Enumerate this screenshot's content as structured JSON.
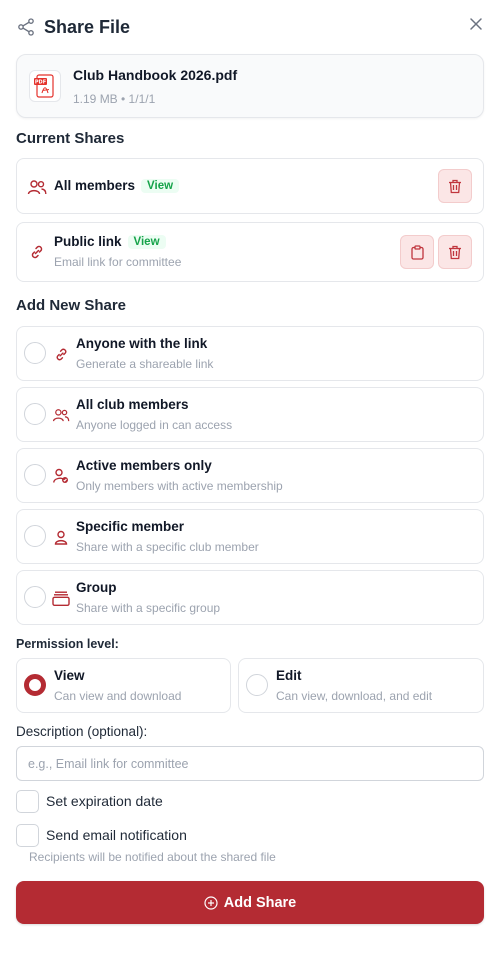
{
  "dialog": {
    "title": "Share File",
    "share_icon": "share-icon",
    "close_icon": "close-icon"
  },
  "file": {
    "name": "Club Handbook 2026.pdf",
    "meta": "1.19 MB • 1/1/1",
    "icon": "pdf-file-icon"
  },
  "current_shares": {
    "title": "Current Shares",
    "items": [
      {
        "label": "All members",
        "badge": "View",
        "icon": "users-icon"
      },
      {
        "label": "Public link",
        "badge": "View",
        "subtitle": "Email link for committee",
        "icon": "link-icon"
      }
    ]
  },
  "add_share": {
    "title": "Add New Share",
    "options": [
      {
        "label": "Anyone with the link",
        "subtitle": "Generate a shareable link",
        "icon": "link-icon"
      },
      {
        "label": "All club members",
        "subtitle": "Anyone logged in can access",
        "icon": "users-icon"
      },
      {
        "label": "Active members only",
        "subtitle": "Only members with active membership",
        "icon": "user-check-icon"
      },
      {
        "label": "Specific member",
        "subtitle": "Share with a specific club member",
        "icon": "user-icon"
      },
      {
        "label": "Group",
        "subtitle": "Share with a specific group",
        "icon": "group-icon"
      }
    ]
  },
  "permission": {
    "label": "Permission level:",
    "options": [
      {
        "label": "View",
        "subtitle": "Can view and download",
        "selected": true
      },
      {
        "label": "Edit",
        "subtitle": "Can view, download, and edit",
        "selected": false
      }
    ]
  },
  "description": {
    "label": "Description (optional):",
    "placeholder": "e.g., Email link for committee",
    "value": ""
  },
  "expiration": {
    "label": "Set expiration date",
    "checked": false
  },
  "notification": {
    "label": "Send email notification",
    "checked": false,
    "hint": "Recipients will be notified about the shared file"
  },
  "submit": {
    "label": "Add Share",
    "icon": "plus-circle-icon"
  },
  "colors": {
    "primary": "#b42b33",
    "badge_text": "#16a34a",
    "badge_bg": "#ecfdf3",
    "danger_bg": "#fbe6e6",
    "muted": "#9ca3af"
  }
}
